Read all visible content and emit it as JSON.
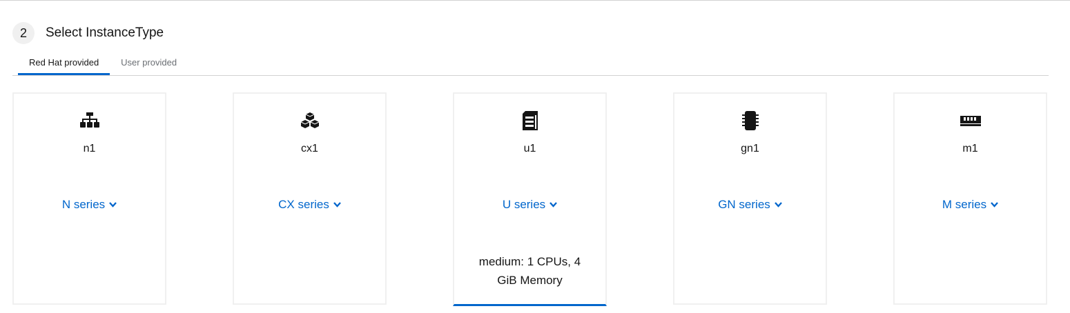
{
  "step": {
    "number": "2",
    "title": "Select InstanceType"
  },
  "tabs": [
    {
      "label": "Red Hat provided",
      "active": true
    },
    {
      "label": "User provided",
      "active": false
    }
  ],
  "cards": [
    {
      "icon": "network-icon",
      "name": "n1",
      "series": "N series",
      "selected": false,
      "size": ""
    },
    {
      "icon": "cubes-icon",
      "name": "cx1",
      "series": "CX series",
      "selected": false,
      "size": ""
    },
    {
      "icon": "server-icon",
      "name": "u1",
      "series": "U series",
      "selected": true,
      "size": "medium: 1 CPUs, 4 GiB Memory"
    },
    {
      "icon": "chip-icon",
      "name": "gn1",
      "series": "GN series",
      "selected": false,
      "size": ""
    },
    {
      "icon": "memory-icon",
      "name": "m1",
      "series": "M series",
      "selected": false,
      "size": ""
    }
  ],
  "colors": {
    "accent": "#0066cc",
    "border": "#f0f0f0",
    "text": "#151515",
    "muted": "#6a6e73"
  }
}
